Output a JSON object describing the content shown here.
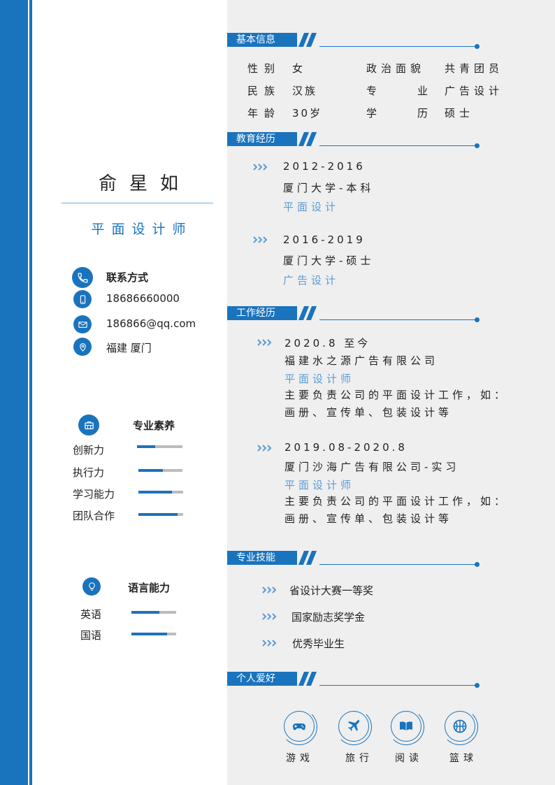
{
  "profile": {
    "name": "俞星如",
    "job_title": "平面设计师"
  },
  "contact": {
    "heading": "联系方式",
    "phone": "18686660000",
    "email": "186866@qq.com",
    "location": "福建 厦门"
  },
  "competence": {
    "heading": "专业素养",
    "items": [
      {
        "label": "创新力",
        "level": 0.4
      },
      {
        "label": "执行力",
        "level": 0.55
      },
      {
        "label": "学习能力",
        "level": 0.75
      },
      {
        "label": "团队合作",
        "level": 0.88
      }
    ]
  },
  "language": {
    "heading": "语言能力",
    "items": [
      {
        "label": "英语",
        "level": 0.62
      },
      {
        "label": "国语",
        "level": 0.8
      }
    ]
  },
  "basic_info": {
    "heading": "基本信息",
    "gender_label": "性别",
    "gender_value": "女",
    "political_label": "政治面貌",
    "political_value": "共青团员",
    "ethnicity_label": "民族",
    "ethnicity_value": "汉族",
    "major_label": "专业",
    "major_value": "广告设计",
    "age_label": "年龄",
    "age_value": "30岁",
    "degree_label": "学历",
    "degree_value": "硕士"
  },
  "education": {
    "heading": "教育经历",
    "items": [
      {
        "years": "2012-2016",
        "school": "厦门大学-本科",
        "major": "平面设计"
      },
      {
        "years": "2016-2019",
        "school": "厦门大学-硕士",
        "major": "广告设计"
      }
    ]
  },
  "work": {
    "heading": "工作经历",
    "items": [
      {
        "period": "2020.8 至今",
        "company": "福建水之源广告有限公司",
        "role": "平面设计师",
        "desc_line1": "主要负责公司的平面设计工作，如：",
        "desc_line2": "画册、宣传单、包装设计等"
      },
      {
        "period": "2019.08-2020.8",
        "company": "厦门沙海广告有限公司-实习",
        "role": "平面设计师",
        "desc_line1": "主要负责公司的平面设计工作，如：",
        "desc_line2": "画册、宣传单、包装设计等"
      }
    ]
  },
  "skills": {
    "heading": "专业技能",
    "items": [
      "省设计大赛一等奖",
      "国家励志奖学金",
      "优秀毕业生"
    ]
  },
  "hobbies": {
    "heading": "个人爱好",
    "items": [
      {
        "label": "游戏",
        "icon": "gamepad-icon"
      },
      {
        "label": "旅行",
        "icon": "airplane-icon"
      },
      {
        "label": "阅读",
        "icon": "book-icon"
      },
      {
        "label": "篮球",
        "icon": "basketball-icon"
      }
    ]
  },
  "colors": {
    "accent": "#1a73bd",
    "accent_light": "#5b9bd5",
    "panel": "#efefef",
    "bar_track": "#bcbcbc"
  }
}
